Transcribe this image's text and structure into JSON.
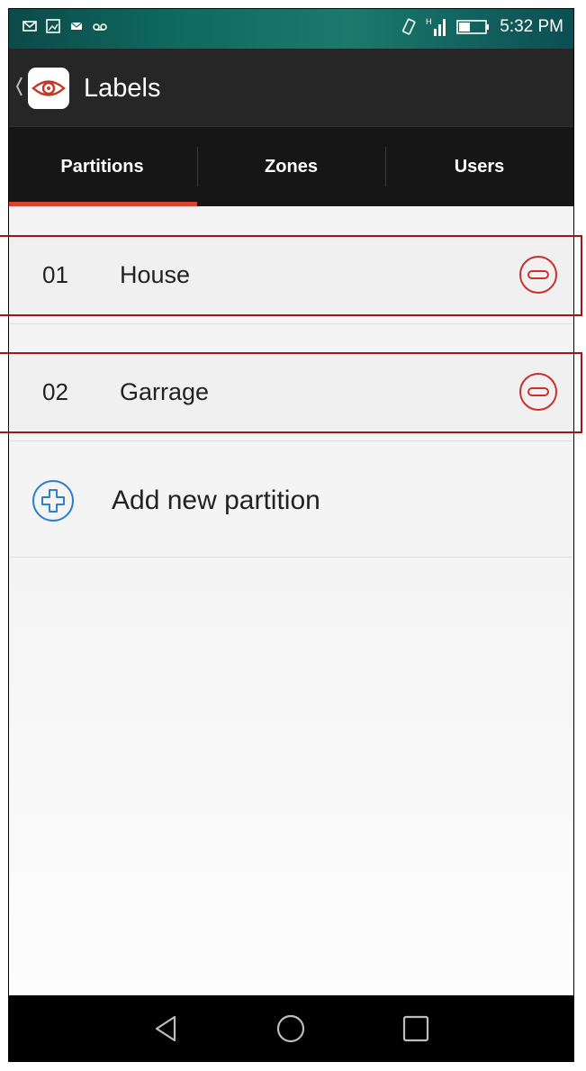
{
  "status_bar": {
    "left_icons": [
      "mail-icon",
      "image-icon",
      "message-icon",
      "voicemail-icon"
    ],
    "right_icons": [
      "vibrate-icon",
      "signal-icon",
      "battery-icon"
    ],
    "signal_tag": "H",
    "time": "5:32 PM"
  },
  "action_bar": {
    "title": "Labels",
    "back_icon": "chevron-left-icon",
    "logo_icon": "eye-icon"
  },
  "tabs": [
    {
      "label": "Partitions",
      "selected": true
    },
    {
      "label": "Zones",
      "selected": false
    },
    {
      "label": "Users",
      "selected": false
    }
  ],
  "partitions": [
    {
      "number": "01",
      "name": "House"
    },
    {
      "number": "02",
      "name": "Garrage"
    }
  ],
  "add_partition": {
    "label": "Add new partition",
    "icon": "plus-circle-icon"
  },
  "nav_bar": {
    "buttons": [
      "back-triangle-icon",
      "home-circle-icon",
      "recents-square-icon"
    ]
  },
  "colors": {
    "accent": "#d9422e",
    "remove": "#c9302c",
    "add": "#2f7fd0",
    "highlight_box": "#a31515",
    "actionbar": "#262626",
    "tabbar": "#161616"
  }
}
